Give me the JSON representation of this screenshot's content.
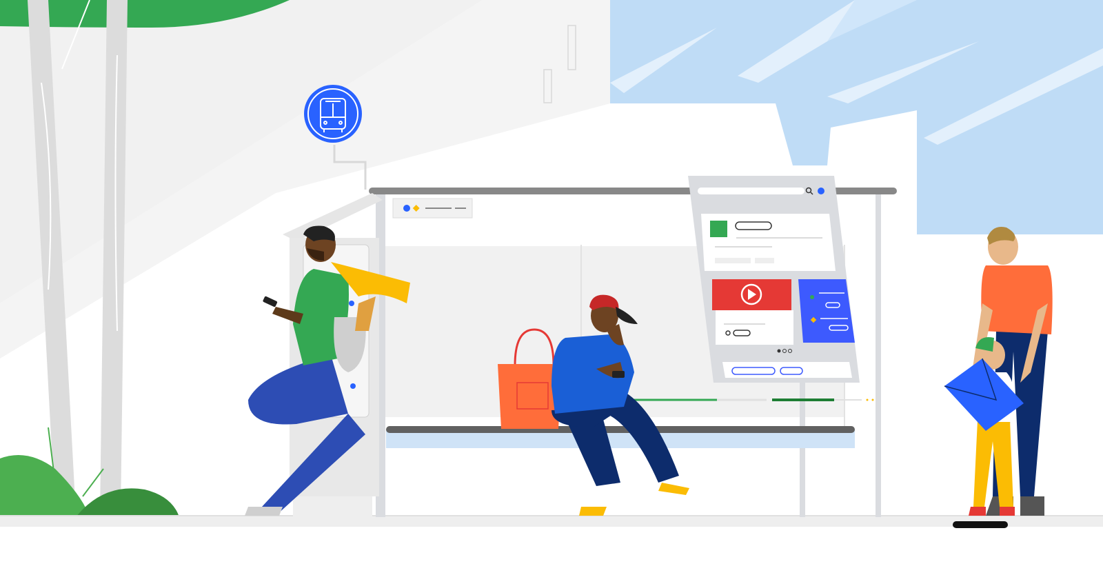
{
  "scene": {
    "description_label": "",
    "colors": {
      "background": "#ffffff",
      "wall_light": "#f1f1f1",
      "sky": "#bfdcf6",
      "foliage": "#34a853",
      "foliage_dark": "#2e8b45",
      "shelter_frame": "#dadce0",
      "shelter_roof": "#888888",
      "bus_stop_sign": "#2962ff",
      "sidewalk": "#eeeeee",
      "accent_red": "#e53935",
      "accent_blue": "#3d5afe",
      "accent_green": "#34a853",
      "accent_yellow": "#fbbc04",
      "accent_orange": "#ff6d3a"
    },
    "icons": [
      "bus-icon",
      "search-icon",
      "play-icon"
    ],
    "display": {
      "carousel_dots": 3,
      "active_dot": 1
    }
  }
}
